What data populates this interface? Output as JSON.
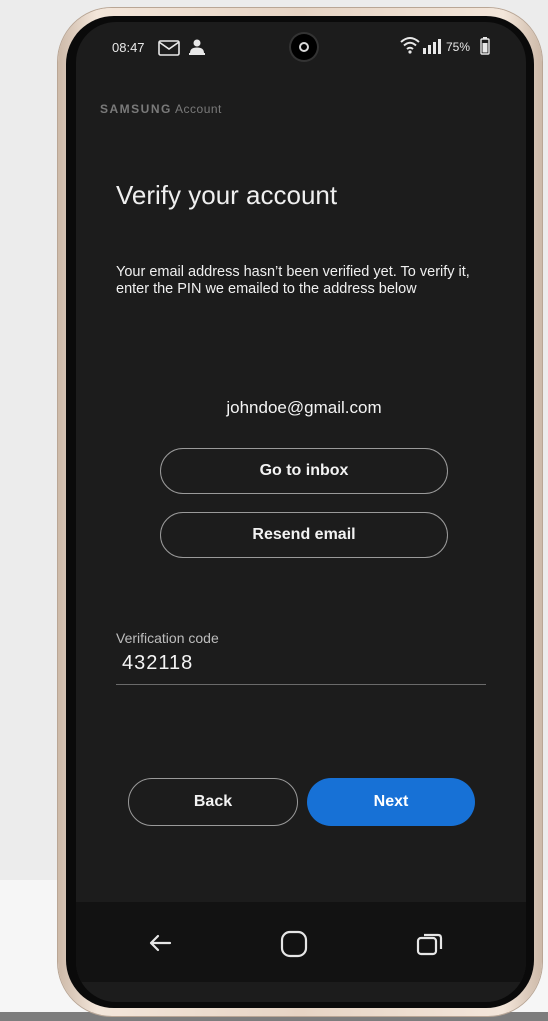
{
  "status_bar": {
    "time": "08:47",
    "battery": "75%",
    "icons": [
      "mail-icon",
      "person-icon",
      "wifi-icon",
      "signal-icon",
      "battery-icon"
    ]
  },
  "header": {
    "brand": "SAMSUNG",
    "product": "Account"
  },
  "main": {
    "title": "Verify your account",
    "description": "Your email address hasn’t been verified yet. To verify it, enter the PIN we emailed to the address below",
    "email": "johndoe@gmail.com",
    "go_to_inbox_label": "Go to inbox",
    "resend_email_label": "Resend email",
    "code_label": "Verification code",
    "code_value": "432118"
  },
  "footer": {
    "back_label": "Back",
    "next_label": "Next"
  },
  "nav_bar": {
    "icons": [
      "back-arrow-icon",
      "home-icon",
      "recents-icon"
    ]
  },
  "colors": {
    "screen_bg": "#1c1c1c",
    "primary_button": "#1771d6",
    "text": "#f0f0f0",
    "muted_text": "#7a7a7a"
  }
}
